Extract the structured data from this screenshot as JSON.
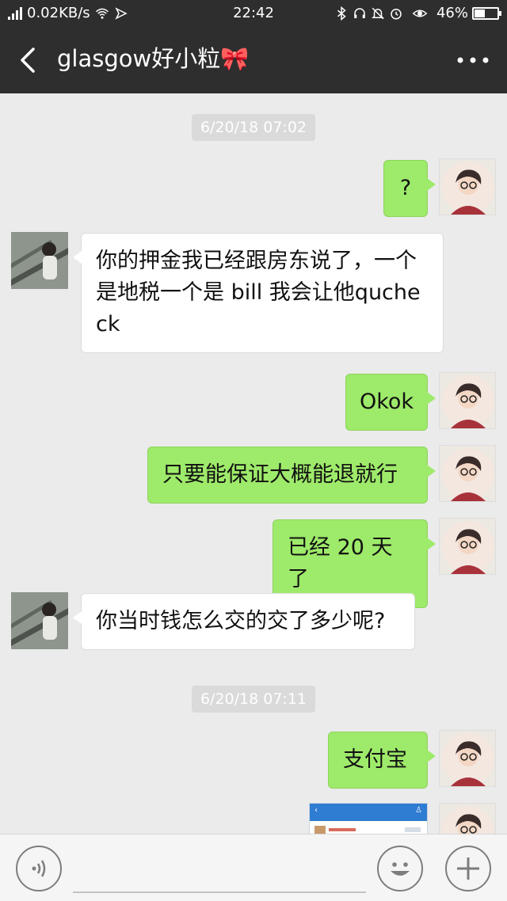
{
  "status_bar": {
    "network_speed": "0.02KB/s",
    "time": "22:42",
    "battery": "46%",
    "battery_level": 0.46,
    "icons": [
      "signal-icon",
      "wifi-icon",
      "location-icon",
      "bluetooth-icon",
      "headset-icon",
      "mute-icon",
      "alarm-icon",
      "eye-icon",
      "battery-icon"
    ]
  },
  "header": {
    "title": "glasgow好小粒🎀",
    "back_icon": "chevron-left-icon",
    "more_icon": "more-dots-icon"
  },
  "messages": {
    "ts1": "6/20/18 07:02",
    "m1": "?",
    "m2": "你的押金我已经跟房东说了，一个是地税一个是 bill 我会让他qucheck",
    "m3": "Okok",
    "m4": "只要能保证大概能退就行",
    "m5": "已经 20 天了",
    "m6": "你当时钱怎么交的交了多少呢?",
    "ts2": "6/20/18 07:11",
    "m7": "支付宝"
  },
  "input_bar": {
    "voice_icon": "voice-icon",
    "emoji_icon": "emoji-icon",
    "plus_icon": "plus-icon"
  },
  "colors": {
    "header_bg": "#2e2e2e",
    "chat_bg": "#ebebeb",
    "my_bubble": "#9eea6a",
    "their_bubble": "#ffffff"
  }
}
